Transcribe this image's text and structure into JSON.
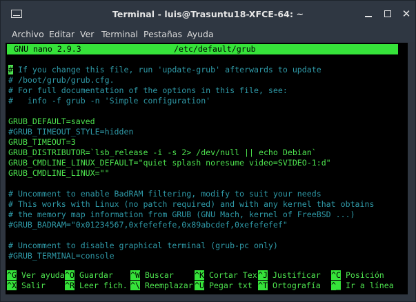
{
  "window": {
    "title": "Terminal - luis@Trasuntu18-XFCE-64: ~",
    "buttons": {
      "minimize": "minimize-icon",
      "maximize": "maximize-icon",
      "close": "close-icon"
    }
  },
  "menu": [
    "Archivo",
    "Editar",
    "Ver",
    "Terminal",
    "Pestañas",
    "Ayuda"
  ],
  "nano": {
    "version": "GNU nano 2.9.3",
    "file": "/etc/default/grub"
  },
  "lines": [
    {
      "text": " If you change this file, run 'update-grub' afterwards to update",
      "cls": "teal",
      "cursor": "#"
    },
    {
      "text": "# /boot/grub/grub.cfg.",
      "cls": "teal"
    },
    {
      "text": "# For full documentation of the options in this file, see:",
      "cls": "teal"
    },
    {
      "text": "#   info -f grub -n 'Simple configuration'",
      "cls": "teal"
    },
    {
      "text": "",
      "cls": "green"
    },
    {
      "text": "GRUB_DEFAULT=saved",
      "cls": "green"
    },
    {
      "text": "#GRUB_TIMEOUT_STYLE=hidden",
      "cls": "teal"
    },
    {
      "text": "GRUB_TIMEOUT=3",
      "cls": "green"
    },
    {
      "text": "GRUB_DISTRIBUTOR=`lsb_release -i -s 2> /dev/null || echo Debian`",
      "cls": "green"
    },
    {
      "text": "GRUB_CMDLINE_LINUX_DEFAULT=\"quiet splash noresume video=SVIDEO-1:d\"",
      "cls": "green"
    },
    {
      "text": "GRUB_CMDLINE_LINUX=\"\"",
      "cls": "green"
    },
    {
      "text": "",
      "cls": "green"
    },
    {
      "text": "# Uncomment to enable BadRAM filtering, modify to suit your needs",
      "cls": "teal"
    },
    {
      "text": "# This works with Linux (no patch required) and with any kernel that obtains",
      "cls": "teal"
    },
    {
      "text": "# the memory map information from GRUB (GNU Mach, kernel of FreeBSD ...)",
      "cls": "teal"
    },
    {
      "text": "#GRUB_BADRAM=\"0x01234567,0xfefefefe,0x89abcdef,0xefefefef\"",
      "cls": "teal"
    },
    {
      "text": "",
      "cls": "green"
    },
    {
      "text": "# Uncomment to disable graphical terminal (grub-pc only)",
      "cls": "teal"
    },
    {
      "text": "#GRUB_TERMINAL=console",
      "cls": "teal"
    }
  ],
  "shortcuts": [
    [
      {
        "key": "^G",
        "label": " Ver ayuda"
      },
      {
        "key": "^O",
        "label": " Guardar"
      },
      {
        "key": "^W",
        "label": " Buscar"
      },
      {
        "key": "^K",
        "label": " Cortar Tex"
      },
      {
        "key": "^J",
        "label": " Justificar"
      },
      {
        "key": "^C",
        "label": " Posición"
      }
    ],
    [
      {
        "key": "^X",
        "label": " Salir"
      },
      {
        "key": "^R",
        "label": " Leer fich."
      },
      {
        "key": "^\\",
        "label": " Reemplazar"
      },
      {
        "key": "^U",
        "label": " Pegar txt"
      },
      {
        "key": "^T",
        "label": " Ortografía"
      },
      {
        "key": "^_",
        "label": " Ir a línea"
      }
    ]
  ]
}
